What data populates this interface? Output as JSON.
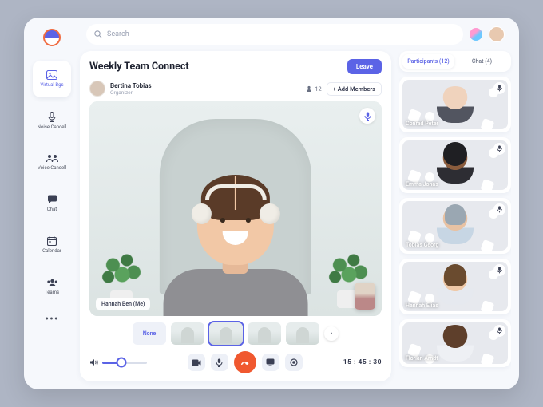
{
  "search": {
    "placeholder": "Search"
  },
  "sidebar": {
    "items": [
      {
        "label": "Virtual Bgs"
      },
      {
        "label": "Noise Cancell"
      },
      {
        "label": "Voice Cancell"
      },
      {
        "label": "Chat"
      },
      {
        "label": "Calendar"
      },
      {
        "label": "Teams"
      }
    ],
    "more": "•••"
  },
  "meeting": {
    "title": "Weekly Team Connect",
    "leave": "Leave",
    "organizer": {
      "name": "Bertina Tobias",
      "role": "Organizer"
    },
    "participant_count": "12",
    "add_members": "+  Add Members",
    "self_label": "Hannah Ben (Me)",
    "bg_none": "None",
    "timer": "15 : 45 : 30"
  },
  "right": {
    "tabs": {
      "participants": "Participants (12)",
      "chat": "Chat (4)"
    },
    "people": [
      {
        "name": "Conrad Peter"
      },
      {
        "name": "Emma Jonas"
      },
      {
        "name": "Tobias Georg"
      },
      {
        "name": "Hannah Elias"
      },
      {
        "name": "Florian Arndt"
      }
    ]
  }
}
